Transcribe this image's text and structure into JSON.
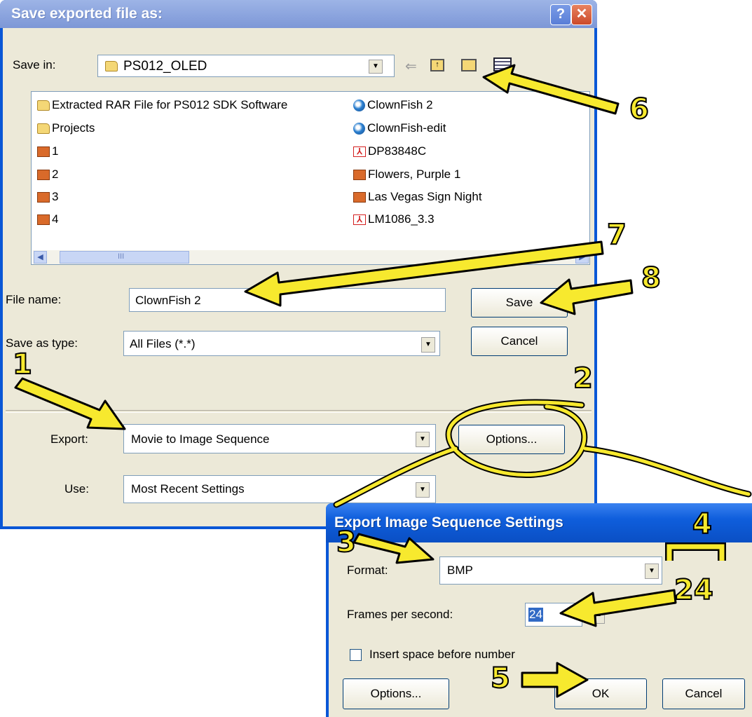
{
  "save_dialog": {
    "title": "Save exported file as:",
    "help_label": "?",
    "close_label": "✕",
    "save_in_label": "Save in:",
    "save_in_value": "PS012_OLED",
    "files_left": [
      {
        "name": "Extracted RAR File for PS012 SDK Software",
        "icon": "folder-icon"
      },
      {
        "name": "Projects",
        "icon": "folder-icon"
      },
      {
        "name": "1",
        "icon": "powerpoint-file-icon"
      },
      {
        "name": "2",
        "icon": "powerpoint-file-icon"
      },
      {
        "name": "3",
        "icon": "powerpoint-file-icon"
      },
      {
        "name": "4",
        "icon": "powerpoint-file-icon"
      }
    ],
    "files_right": [
      {
        "name": "ClownFish 2",
        "icon": "quicktime-file-icon"
      },
      {
        "name": "ClownFish-edit",
        "icon": "quicktime-file-icon"
      },
      {
        "name": "DP83848C",
        "icon": "pdf-file-icon"
      },
      {
        "name": "Flowers, Purple 1",
        "icon": "powerpoint-file-icon"
      },
      {
        "name": "Las Vegas Sign Night",
        "icon": "powerpoint-file-icon"
      },
      {
        "name": "LM1086_3.3",
        "icon": "pdf-file-icon"
      }
    ],
    "scroll_grip": "III",
    "file_name_label": "File name:",
    "file_name_value": "ClownFish 2",
    "save_as_type_label": "Save as type:",
    "save_as_type_value": "All Files (*.*)",
    "save_button": "Save",
    "cancel_button": "Cancel",
    "export_label": "Export:",
    "export_value": "Movie to Image Sequence",
    "options_button": "Options...",
    "use_label": "Use:",
    "use_value": "Most Recent Settings"
  },
  "export_dialog": {
    "title": "Export Image Sequence Settings",
    "format_label": "Format:",
    "format_value": "BMP",
    "fps_label": "Frames per second:",
    "fps_value": "24",
    "insert_space_label": "Insert space before number",
    "insert_space_checked": false,
    "options_button": "Options...",
    "ok_button": "OK",
    "cancel_button": "Cancel"
  },
  "annotations": {
    "step1": "1",
    "step2": "2",
    "step3": "3",
    "step4": "4",
    "step5": "5",
    "step6": "6",
    "step7": "7",
    "step8": "8",
    "fps_callout": "24",
    "color": "#f7e92e"
  }
}
